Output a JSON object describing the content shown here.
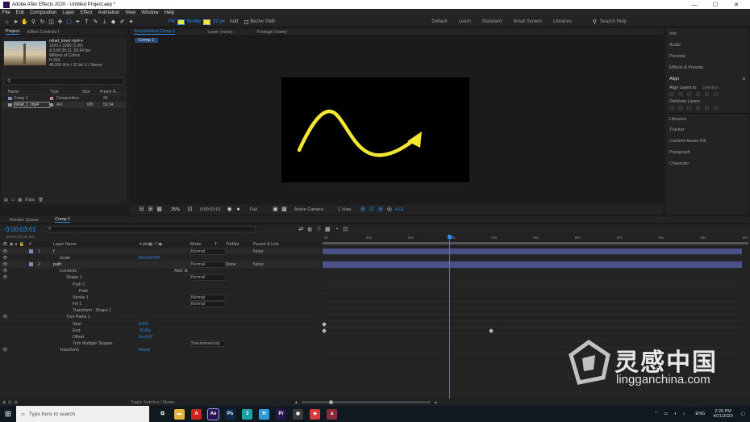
{
  "window": {
    "title": "Adobe After Effects 2020 - Untitled Project.aep *",
    "controls": [
      "—",
      "☐",
      "✕"
    ]
  },
  "menu": [
    "File",
    "Edit",
    "Composition",
    "Layer",
    "Effect",
    "Animation",
    "View",
    "Window",
    "Help"
  ],
  "toolbar": {
    "fill_label": "Fill",
    "stroke_label": "Stroke",
    "stroke_px": "32 px",
    "add_label": "Add",
    "bezier_label": "Bezier Path",
    "workspaces": [
      "Default",
      "Learn",
      "Standard",
      "Small Screen",
      "Libraries"
    ],
    "active_workspace": "Default",
    "search_placeholder": "Search Help",
    "fill_color": "#f3e733",
    "stroke_color": "#f3e733"
  },
  "project": {
    "tab_project": "Project",
    "tab_effects": "Effect Controls f",
    "footage_name": "milad_tower.mp4 ▾",
    "footage_info": [
      "1920 x 1080 (1.00)",
      "Δ 0;00;35;11, 59.94 fps",
      "Millions of Colors",
      "H.264",
      "48.000 kHz / 32 bit U / Stereo"
    ],
    "columns": [
      "Name",
      "Type",
      "Size",
      "Frame R..."
    ],
    "items": [
      {
        "name": "Comp 1",
        "type": "Composition",
        "size": "",
        "rate": "25"
      },
      {
        "name": "milad_t...mp4",
        "type": "AVI",
        "size": "MB",
        "rate": "59.94"
      }
    ],
    "bpc": "8 bpc"
  },
  "viewer": {
    "tabs": [
      "Composition Comp 1",
      "Layer (none)",
      "Footage (none)"
    ],
    "comp_tab": "Comp 1",
    "zoom": "25%",
    "timecode": "0:00:03:01",
    "resolution": "Full",
    "camera": "Active Camera",
    "views": "1 View",
    "exposure": "+0.0",
    "path_color": "#f3e733"
  },
  "right_panels": {
    "items": [
      "Info",
      "Audio",
      "Preview",
      "Effects & Presets",
      "Align",
      "Libraries",
      "Tracker",
      "Content-Aware Fill",
      "Paragraph",
      "Character"
    ],
    "align_to_label": "Align Layers to:",
    "align_to_value": "Selection",
    "distribute_label": "Distribute Layers:"
  },
  "timeline": {
    "tabs": [
      "Render Queue",
      "Comp 1"
    ],
    "timecode": "0:00:03:01",
    "fps_info": "00076 (25.00 fps)",
    "column_headers": [
      "#",
      "Layer Name",
      "Mode",
      "T",
      "TrkMat",
      "Parent & Link"
    ],
    "ruler": [
      "0s",
      "01s",
      "02s",
      "03s",
      "04s",
      "05s",
      "06s",
      "07s",
      "08s",
      "09s",
      "10s"
    ],
    "rows": [
      {
        "num": "1",
        "name": "f",
        "indent": 0,
        "mode": "Normal",
        "trk": "",
        "parent": "None",
        "kind": "layer"
      },
      {
        "num": "",
        "name": "Scale",
        "indent": 1,
        "value": "60.0,60.0%",
        "kind": "prop"
      },
      {
        "num": "2",
        "name": "path",
        "indent": 0,
        "mode": "Normal",
        "trk": "None",
        "parent": "None",
        "kind": "layer"
      },
      {
        "num": "",
        "name": "Contents",
        "indent": 1,
        "add": "Add: ⊕",
        "kind": "prop"
      },
      {
        "num": "",
        "name": "Shape 1",
        "indent": 2,
        "mode": "Normal",
        "kind": "prop"
      },
      {
        "num": "",
        "name": "Path 1",
        "indent": 3,
        "kind": "prop"
      },
      {
        "num": "",
        "name": "Path",
        "indent": 4,
        "kind": "prop"
      },
      {
        "num": "",
        "name": "Stroke 1",
        "indent": 3,
        "mode": "Normal",
        "kind": "prop"
      },
      {
        "num": "",
        "name": "Fill 1",
        "indent": 3,
        "mode": "Normal",
        "kind": "prop"
      },
      {
        "num": "",
        "name": "Transform : Shape 1",
        "indent": 3,
        "kind": "prop"
      },
      {
        "num": "",
        "name": "Trim Paths 1",
        "indent": 2,
        "kind": "prop"
      },
      {
        "num": "",
        "name": "Start",
        "indent": 3,
        "value": "0.0%",
        "kind": "prop"
      },
      {
        "num": "",
        "name": "End",
        "indent": 3,
        "value": "78.6%",
        "kind": "prop"
      },
      {
        "num": "",
        "name": "Offset",
        "indent": 3,
        "value": "0x+0.0°",
        "kind": "prop"
      },
      {
        "num": "",
        "name": "Trim Multiple Shapes",
        "indent": 3,
        "mode": "Simultaneously",
        "kind": "prop"
      },
      {
        "num": "",
        "name": "Transform",
        "indent": 1,
        "value": "Reset",
        "kind": "prop"
      }
    ],
    "toggle_label": "Toggle Switches / Modes",
    "playhead_label_color": "#2d8ceb",
    "layer_bar_color": "#4a5186"
  },
  "taskbar": {
    "search_placeholder": "Type here to search",
    "apps": [
      {
        "name": "task-view",
        "glyph": "⧉",
        "color": "#101820"
      },
      {
        "name": "file-explorer",
        "glyph": "▬",
        "color": "#e8b33a"
      },
      {
        "name": "acrobat",
        "glyph": "A",
        "color": "#c8261c"
      },
      {
        "name": "after-effects",
        "glyph": "Ae",
        "color": "#2a1550"
      },
      {
        "name": "photoshop",
        "glyph": "Ps",
        "color": "#0f2a44"
      },
      {
        "name": "app-3",
        "glyph": "3",
        "color": "#1aa2a4"
      },
      {
        "name": "app-h",
        "glyph": "H",
        "color": "#2e9bd6"
      },
      {
        "name": "premiere",
        "glyph": "Pr",
        "color": "#2a1550"
      },
      {
        "name": "app-circle",
        "glyph": "◉",
        "color": "#3a3a3a"
      },
      {
        "name": "app-red",
        "glyph": "◈",
        "color": "#d43a3a"
      },
      {
        "name": "app-a",
        "glyph": "a",
        "color": "#8a2a3a"
      }
    ],
    "lang": "ENG",
    "time": "2:26 PM",
    "date": "4/21/2020"
  },
  "watermark": {
    "cn": "灵感中国",
    "url": "lingganchina.com"
  }
}
